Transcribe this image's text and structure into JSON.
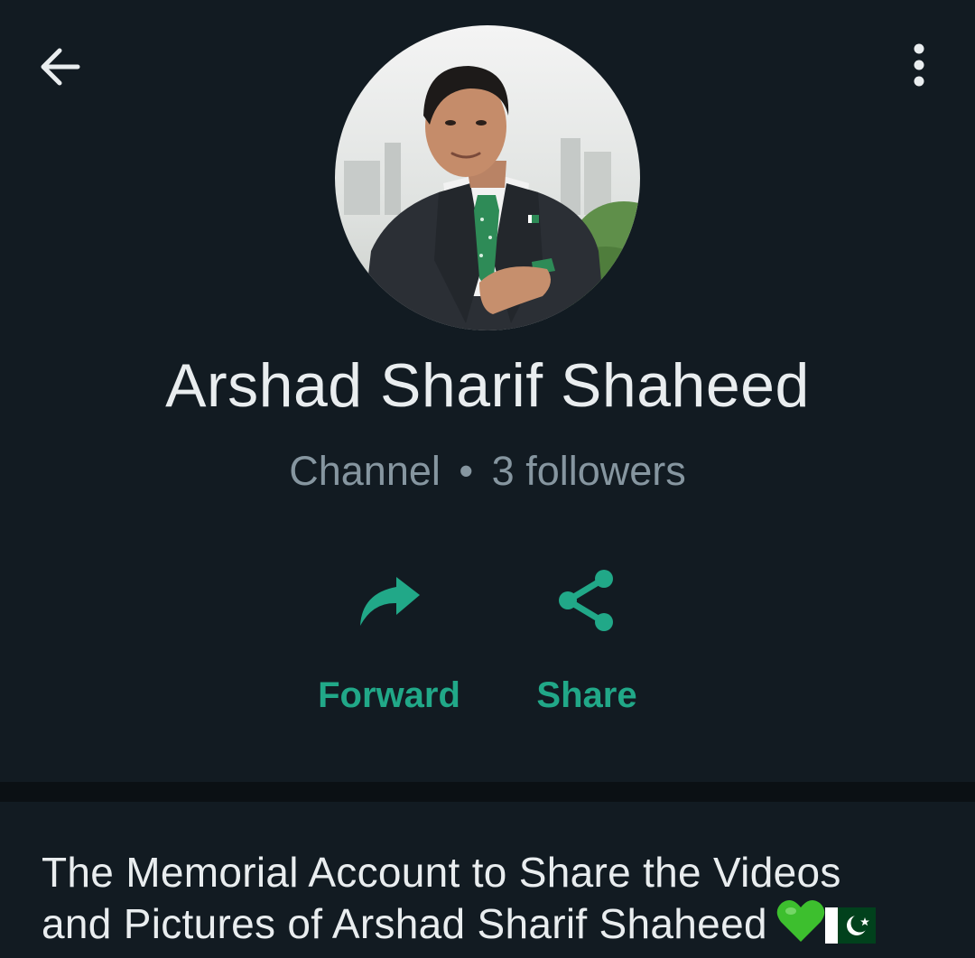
{
  "header": {
    "back_icon": "arrow-left-icon",
    "menu_icon": "more-vertical-icon"
  },
  "channel": {
    "name": "Arshad Sharif Shaheed",
    "type": "Channel",
    "separator": "•",
    "followers": "3 followers"
  },
  "actions": [
    {
      "label": "Forward",
      "icon": "forward-icon"
    },
    {
      "label": "Share",
      "icon": "share-icon"
    }
  ],
  "description": {
    "line1": "The Memorial Account to Share the Videos",
    "line2": "and Pictures of Arshad Sharif Shaheed",
    "emojis": [
      "green-heart",
      "pakistan-flag"
    ]
  },
  "colors": {
    "background": "#121b22",
    "accent": "#21a888",
    "primary_text": "#e9edef",
    "secondary_text": "#8696a0"
  }
}
